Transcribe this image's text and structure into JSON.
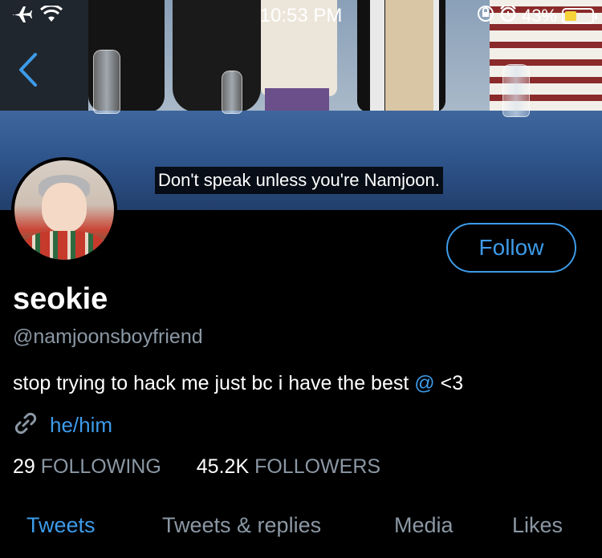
{
  "status_bar": {
    "time": "10:53 PM",
    "battery_percent": "43%",
    "battery_level": 0.43,
    "icons": [
      "airplane-icon",
      "wifi-icon",
      "orientation-lock-icon",
      "alarm-icon",
      "battery-icon"
    ]
  },
  "banner": {
    "caption": "Don't speak unless you're Namjoon."
  },
  "profile": {
    "name": "seokie",
    "handle": "@namjoonsboyfriend",
    "bio_text": "stop trying to hack me just bc i have the best ",
    "bio_mention": "@",
    "bio_end": " <3",
    "link": "he/him",
    "following_count": "29",
    "following_label": "FOLLOWING",
    "followers_count": "45.2K",
    "followers_label": "FOLLOWERS"
  },
  "actions": {
    "follow_label": "Follow"
  },
  "tabs": [
    {
      "label": "Tweets",
      "active": true
    },
    {
      "label": "Tweets & replies",
      "active": false
    },
    {
      "label": "Media",
      "active": false
    },
    {
      "label": "Likes",
      "active": false
    }
  ],
  "colors": {
    "accent": "#3d9be9",
    "secondary_text": "#8b98a5",
    "background": "#000000",
    "battery": "#f7d33a"
  }
}
